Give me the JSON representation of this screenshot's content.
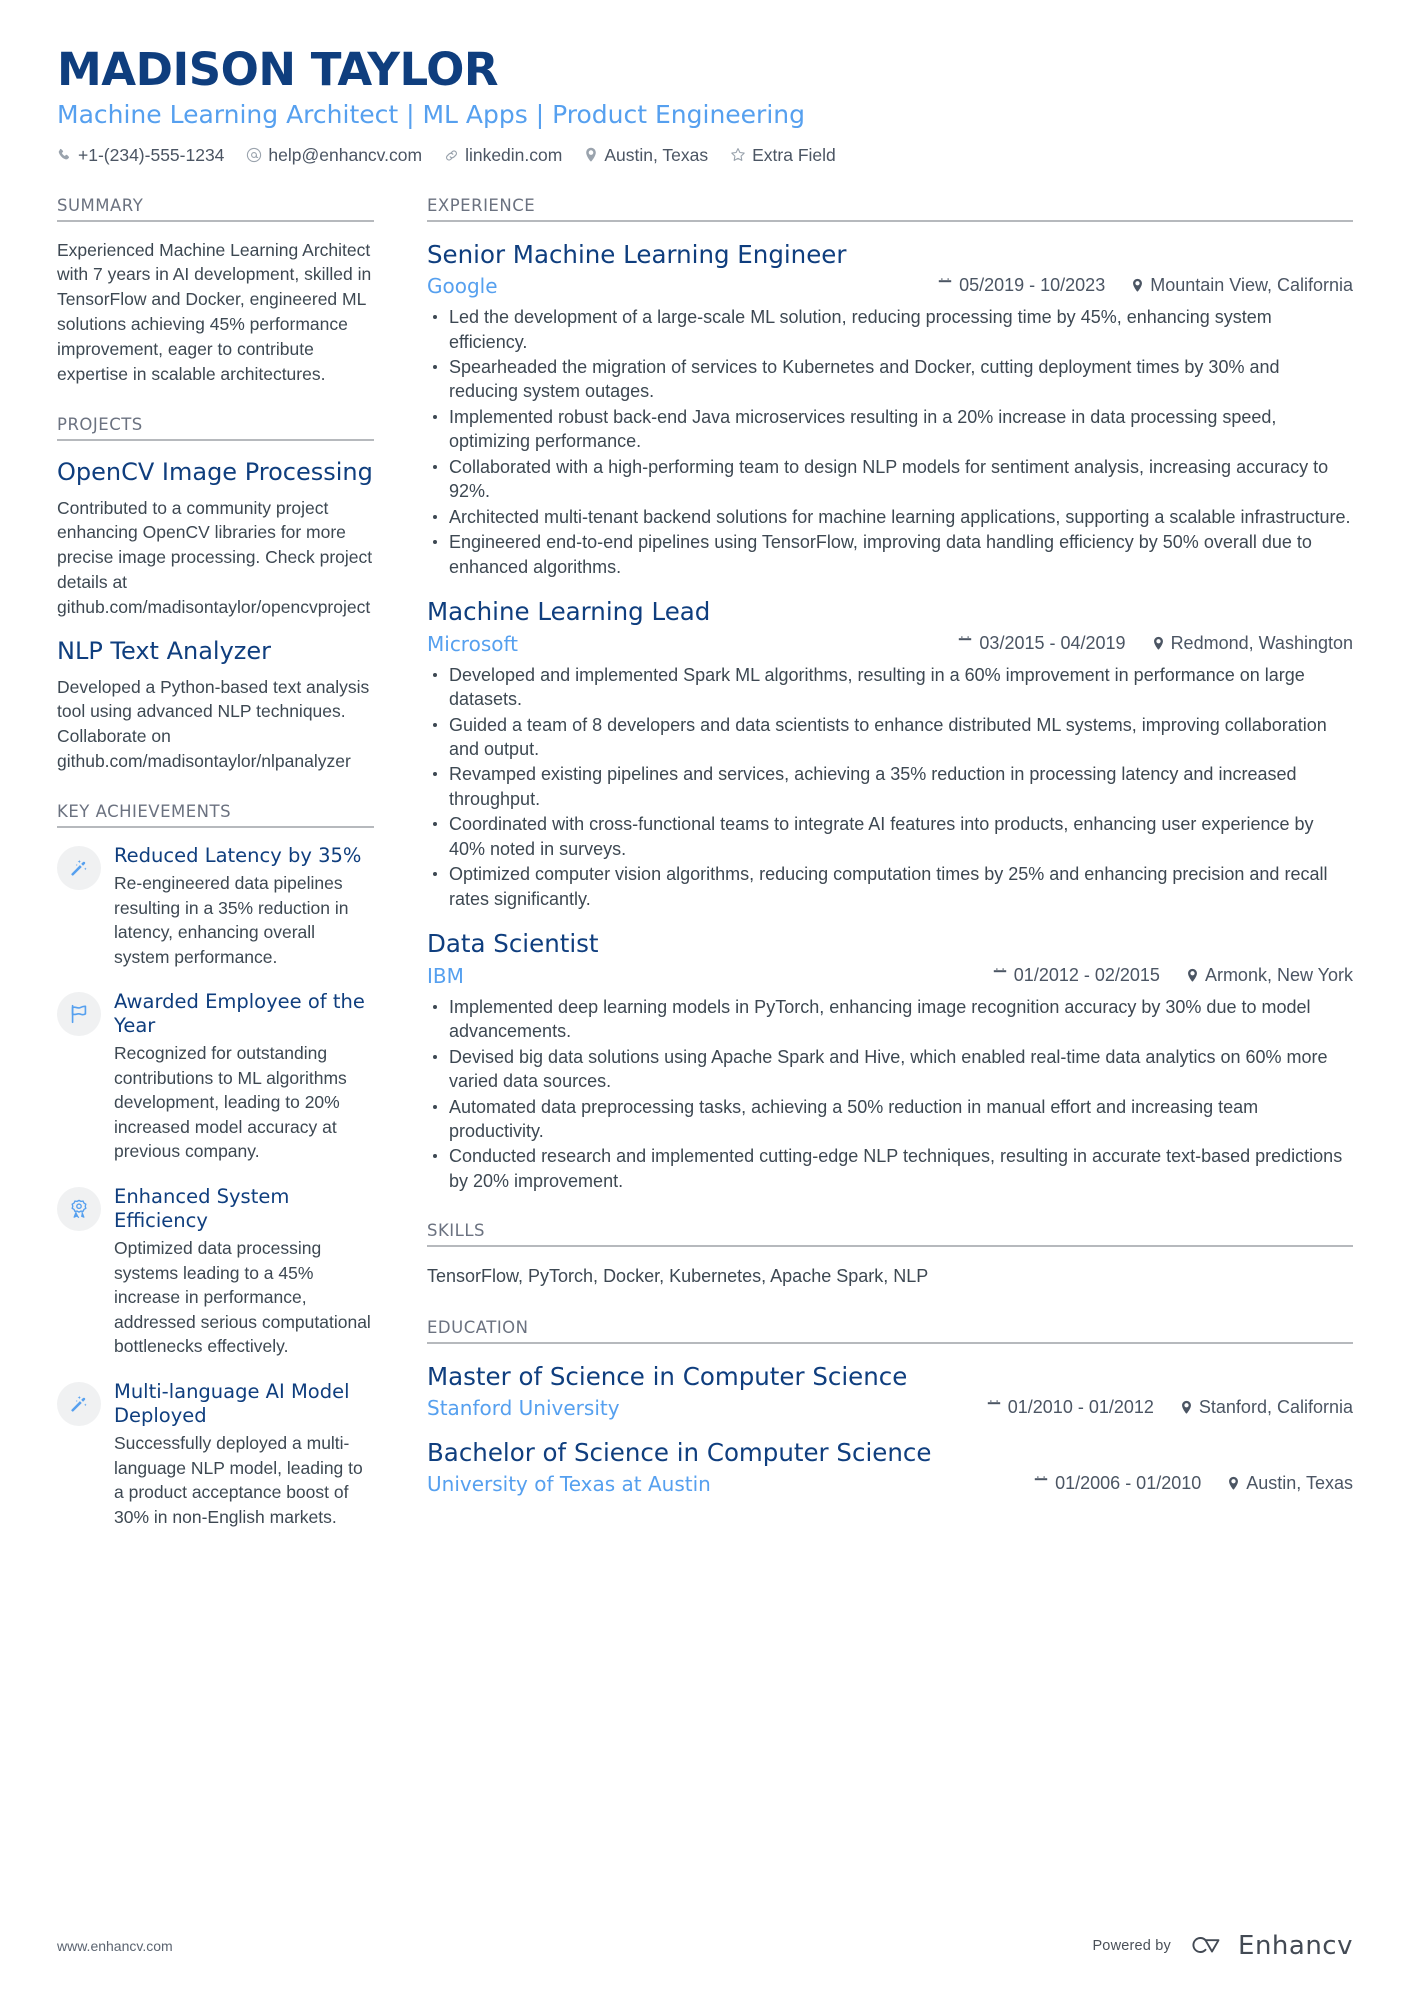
{
  "header": {
    "name": "MADISON TAYLOR",
    "headline": "Machine Learning Architect | ML Apps | Product Engineering",
    "contacts": [
      {
        "icon": "phone-icon",
        "text": "+1-(234)-555-1234"
      },
      {
        "icon": "email-icon",
        "text": "help@enhancv.com"
      },
      {
        "icon": "link-icon",
        "text": "linkedin.com"
      },
      {
        "icon": "location-pin-icon",
        "text": "Austin, Texas"
      },
      {
        "icon": "star-icon",
        "text": "Extra Field"
      }
    ]
  },
  "sidebar": {
    "summary": {
      "title": "SUMMARY",
      "text": "Experienced Machine Learning Architect with 7 years in AI development, skilled in TensorFlow and Docker, engineered ML solutions achieving 45% performance improvement, eager to contribute expertise in scalable architectures."
    },
    "projects": {
      "title": "PROJECTS",
      "items": [
        {
          "title": "OpenCV Image Processing",
          "description": "Contributed to a community project enhancing OpenCV libraries for more precise image processing. Check project details at github.com/madisontaylor/opencvproject"
        },
        {
          "title": "NLP Text Analyzer",
          "description": "Developed a Python-based text analysis tool using advanced NLP techniques. Collaborate on github.com/madisontaylor/nlpanalyzer"
        }
      ]
    },
    "achievements": {
      "title": "KEY ACHIEVEMENTS",
      "items": [
        {
          "icon": "magic-wand-icon",
          "title": "Reduced Latency by 35%",
          "description": "Re-engineered data pipelines resulting in a 35% reduction in latency, enhancing overall system performance."
        },
        {
          "icon": "flag-icon",
          "title": "Awarded Employee of the Year",
          "description": "Recognized for outstanding contributions to ML algorithms development, leading to 20% increased model accuracy at previous company."
        },
        {
          "icon": "award-ribbon-icon",
          "title": "Enhanced System Efficiency",
          "description": "Optimized data processing systems leading to a 45% increase in performance, addressed serious computational bottlenecks effectively."
        },
        {
          "icon": "magic-wand-icon",
          "title": "Multi-language AI Model Deployed",
          "description": "Successfully deployed a multi-language NLP model, leading to a product acceptance boost of 30% in non-English markets."
        }
      ]
    }
  },
  "main": {
    "experience": {
      "title": "EXPERIENCE",
      "items": [
        {
          "role": "Senior Machine Learning Engineer",
          "company": "Google",
          "dates": "05/2019 - 10/2023",
          "location": "Mountain View, California",
          "bullets": [
            "Led the development of a large-scale ML solution, reducing processing time by 45%, enhancing system efficiency.",
            "Spearheaded the migration of services to Kubernetes and Docker, cutting deployment times by 30% and reducing system outages.",
            "Implemented robust back-end Java microservices resulting in a 20% increase in data processing speed, optimizing performance.",
            "Collaborated with a high-performing team to design NLP models for sentiment analysis, increasing accuracy to 92%.",
            "Architected multi-tenant backend solutions for machine learning applications, supporting a scalable infrastructure.",
            "Engineered end-to-end pipelines using TensorFlow, improving data handling efficiency by 50% overall due to enhanced algorithms."
          ]
        },
        {
          "role": "Machine Learning Lead",
          "company": "Microsoft",
          "dates": "03/2015 - 04/2019",
          "location": "Redmond, Washington",
          "bullets": [
            "Developed and implemented Spark ML algorithms, resulting in a 60% improvement in performance on large datasets.",
            "Guided a team of 8 developers and data scientists to enhance distributed ML systems, improving collaboration and output.",
            "Revamped existing pipelines and services, achieving a 35% reduction in processing latency and increased throughput.",
            "Coordinated with cross-functional teams to integrate AI features into products, enhancing user experience by 40% noted in surveys.",
            "Optimized computer vision algorithms, reducing computation times by 25% and enhancing precision and recall rates significantly."
          ]
        },
        {
          "role": "Data Scientist",
          "company": "IBM",
          "dates": "01/2012 - 02/2015",
          "location": "Armonk, New York",
          "bullets": [
            "Implemented deep learning models in PyTorch, enhancing image recognition accuracy by 30% due to model advancements.",
            "Devised big data solutions using Apache Spark and Hive, which enabled real-time data analytics on 60% more varied data sources.",
            "Automated data preprocessing tasks, achieving a 50% reduction in manual effort and increasing team productivity.",
            "Conducted research and implemented cutting-edge NLP techniques, resulting in accurate text-based predictions by 20% improvement."
          ]
        }
      ]
    },
    "skills": {
      "title": "SKILLS",
      "text": "TensorFlow, PyTorch, Docker, Kubernetes, Apache Spark, NLP"
    },
    "education": {
      "title": "EDUCATION",
      "items": [
        {
          "degree": "Master of Science in Computer Science",
          "school": "Stanford University",
          "dates": "01/2010 - 01/2012",
          "location": "Stanford, California"
        },
        {
          "degree": "Bachelor of Science in Computer Science",
          "school": "University of Texas at Austin",
          "dates": "01/2006 - 01/2010",
          "location": "Austin, Texas"
        }
      ]
    }
  },
  "footer": {
    "website": "www.enhancv.com",
    "powered_by": "Powered by",
    "brand": "Enhancv"
  },
  "colors": {
    "navy": "#0f3e7e",
    "light_blue": "#56a0ef",
    "body_text": "#3d4852",
    "rule": "#b6b9bd"
  }
}
